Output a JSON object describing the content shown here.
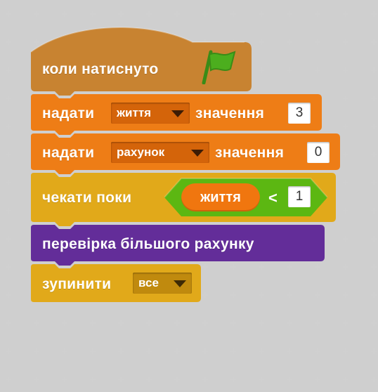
{
  "colors": {
    "events": "#c88331",
    "data": "#ee7d16",
    "control": "#e1a91a",
    "operators": "#5cb712",
    "more_blocks": "#632d99",
    "flag": "#4cae1e"
  },
  "script": {
    "hat_block": {
      "label": "коли  натиснуто",
      "icon": "green-flag-icon"
    },
    "set_lives_block": {
      "label": "надати",
      "variable": "життя",
      "label2": "значення",
      "value": "3"
    },
    "set_score_block": {
      "label": "надати",
      "variable": "рахунок",
      "label2": "значення",
      "value": "0"
    },
    "wait_until_block": {
      "label": "чекати  поки",
      "reporter": "життя",
      "operator": "<",
      "value": "1"
    },
    "custom_block": {
      "label": "перевірка  більшого  рахунку"
    },
    "stop_block": {
      "label": "зупинити",
      "option": "все"
    }
  }
}
